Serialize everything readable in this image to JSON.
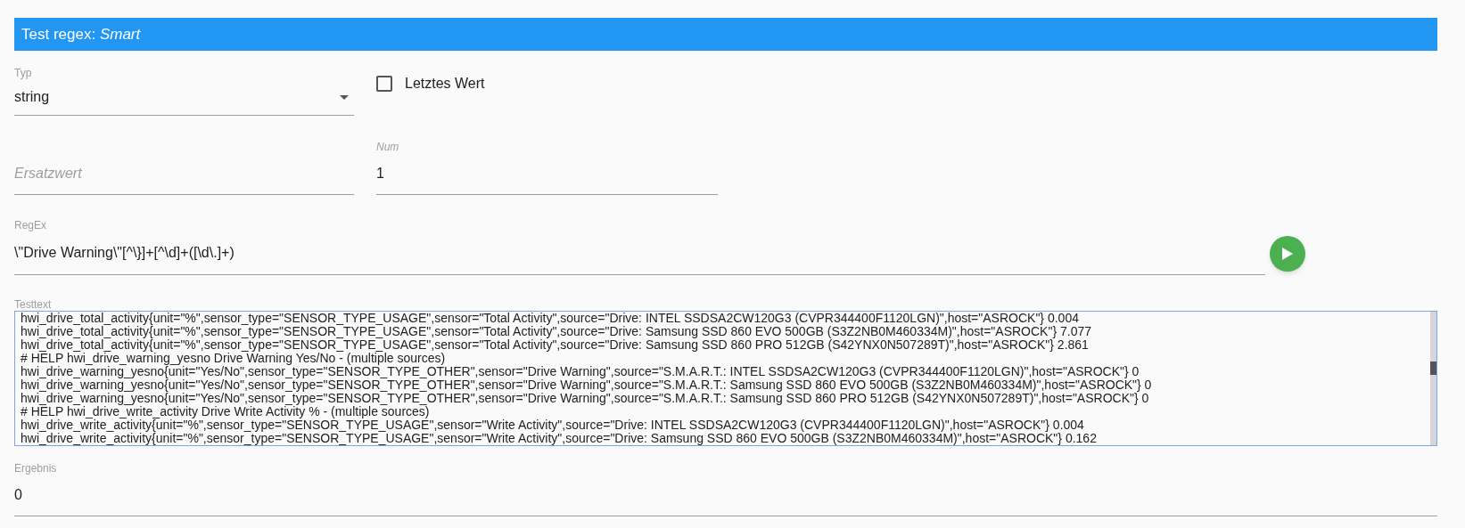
{
  "header": {
    "title": "Test regex: *Smart*"
  },
  "typ": {
    "label": "Typ",
    "value": "string"
  },
  "letztes_wert": {
    "label": "Letztes Wert",
    "checked": false
  },
  "ersatzwert": {
    "placeholder": "Ersatzwert"
  },
  "num": {
    "label": "Num",
    "value": "1"
  },
  "regex": {
    "label": "RegEx",
    "value": "\\\"Drive Warning\\\"[^\\}]+[^\\d]+([\\d\\.]+)"
  },
  "testtext": {
    "label": "Testtext",
    "lines": [
      "hwi_drive_total_activity{unit=\"%\",sensor_type=\"SENSOR_TYPE_USAGE\",sensor=\"Total Activity\",source=\"Drive: INTEL SSDSA2CW120G3 (CVPR344400F1120LGN)\",host=\"ASROCK\"} 0.004",
      "hwi_drive_total_activity{unit=\"%\",sensor_type=\"SENSOR_TYPE_USAGE\",sensor=\"Total Activity\",source=\"Drive: Samsung SSD 860 EVO 500GB (S3Z2NB0M460334M)\",host=\"ASROCK\"} 7.077",
      "hwi_drive_total_activity{unit=\"%\",sensor_type=\"SENSOR_TYPE_USAGE\",sensor=\"Total Activity\",source=\"Drive: Samsung SSD 860 PRO 512GB (S42YNX0N507289T)\",host=\"ASROCK\"} 2.861",
      "# HELP hwi_drive_warning_yesno Drive Warning Yes/No - (multiple sources)",
      "hwi_drive_warning_yesno{unit=\"Yes/No\",sensor_type=\"SENSOR_TYPE_OTHER\",sensor=\"Drive Warning\",source=\"S.M.A.R.T.: INTEL SSDSA2CW120G3 (CVPR344400F1120LGN)\",host=\"ASROCK\"} 0",
      "hwi_drive_warning_yesno{unit=\"Yes/No\",sensor_type=\"SENSOR_TYPE_OTHER\",sensor=\"Drive Warning\",source=\"S.M.A.R.T.: Samsung SSD 860 EVO 500GB (S3Z2NB0M460334M)\",host=\"ASROCK\"} 0",
      "hwi_drive_warning_yesno{unit=\"Yes/No\",sensor_type=\"SENSOR_TYPE_OTHER\",sensor=\"Drive Warning\",source=\"S.M.A.R.T.: Samsung SSD 860 PRO 512GB (S42YNX0N507289T)\",host=\"ASROCK\"} 0",
      "# HELP hwi_drive_write_activity Drive Write Activity % - (multiple sources)",
      "hwi_drive_write_activity{unit=\"%\",sensor_type=\"SENSOR_TYPE_USAGE\",sensor=\"Write Activity\",source=\"Drive: INTEL SSDSA2CW120G3 (CVPR344400F1120LGN)\",host=\"ASROCK\"} 0.004",
      "hwi_drive_write_activity{unit=\"%\",sensor_type=\"SENSOR_TYPE_USAGE\",sensor=\"Write Activity\",source=\"Drive: Samsung SSD 860 EVO 500GB (S3Z2NB0M460334M)\",host=\"ASROCK\"} 0.162"
    ]
  },
  "ergebnis": {
    "label": "Ergebnis",
    "value": "0"
  }
}
